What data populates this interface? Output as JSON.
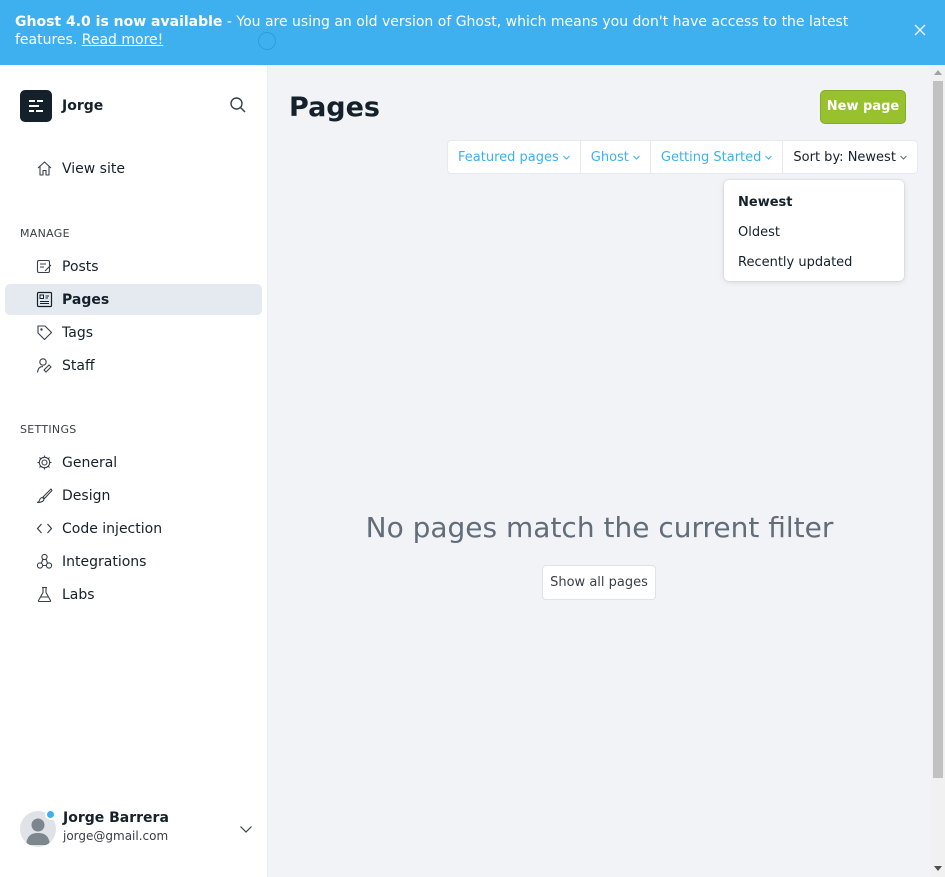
{
  "banner": {
    "bold": "Ghost 4.0 is now available",
    "text": " - You are using an old version of Ghost, which means you don't have access to the latest features. ",
    "link": "Read more!",
    "bg": "#3eb0ef"
  },
  "brand": {
    "name": "Jorge"
  },
  "nav": {
    "view_site": "View site",
    "manage_label": "Manage",
    "manage": [
      {
        "label": "Posts",
        "icon": "posts-icon"
      },
      {
        "label": "Pages",
        "icon": "pages-icon",
        "active": true
      },
      {
        "label": "Tags",
        "icon": "tag-icon"
      },
      {
        "label": "Staff",
        "icon": "staff-icon"
      }
    ],
    "settings_label": "Settings",
    "settings": [
      {
        "label": "General",
        "icon": "gear-icon"
      },
      {
        "label": "Design",
        "icon": "brush-icon"
      },
      {
        "label": "Code injection",
        "icon": "code-icon"
      },
      {
        "label": "Integrations",
        "icon": "integrations-icon"
      },
      {
        "label": "Labs",
        "icon": "flask-icon"
      }
    ]
  },
  "user": {
    "name": "Jorge Barrera",
    "email": "jorge@gmail.com"
  },
  "main": {
    "title": "Pages",
    "new_page": "New page",
    "filters": [
      "Featured pages",
      "Ghost",
      "Getting Started",
      "Sort by: Newest"
    ],
    "sort_options": [
      "Newest",
      "Oldest",
      "Recently updated"
    ],
    "empty_message": "No pages match the current filter",
    "show_all": "Show all pages"
  },
  "colors": {
    "accent": "#3eb0ef",
    "green": "#97c22e",
    "dark": "#15212a"
  }
}
